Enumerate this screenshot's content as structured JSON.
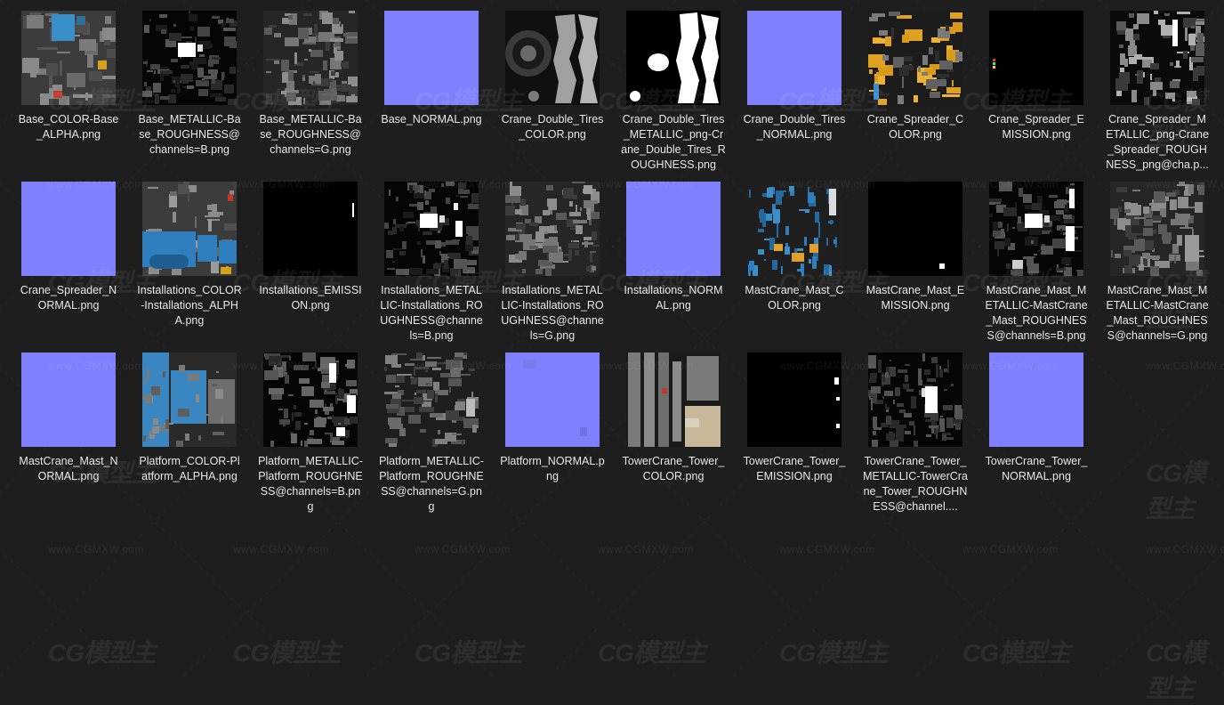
{
  "watermark": {
    "logo": "CG模型主",
    "url": "www.CGMXW.com"
  },
  "files": [
    {
      "name": "Base_COLOR-Base_ALPHA.png",
      "thumb": "color-base",
      "accent": "#3a8fc9"
    },
    {
      "name": "Base_METALLIC-Base_ROUGHNESS@channels=B.png",
      "thumb": "dark-noise",
      "accent": "#ffffff"
    },
    {
      "name": "Base_METALLIC-Base_ROUGHNESS@channels=G.png",
      "thumb": "gray-noise",
      "accent": "#9a9a9a"
    },
    {
      "name": "Base_NORMAL.png",
      "thumb": "normal",
      "accent": "#8080ff"
    },
    {
      "name": "Crane_Double_Tires_COLOR.png",
      "thumb": "tires-gray",
      "accent": "#a8a8a8"
    },
    {
      "name": "Crane_Double_Tires_METALLIC_png-Crane_Double_Tires_ROUGHNESS.png",
      "thumb": "tires-white",
      "accent": "#ffffff"
    },
    {
      "name": "Crane_Double_Tires_NORMAL.png",
      "thumb": "normal",
      "accent": "#8080ff"
    },
    {
      "name": "Crane_Spreader_COLOR.png",
      "thumb": "spreader-color",
      "accent": "#f0b030"
    },
    {
      "name": "Crane_Spreader_EMISSION.png",
      "thumb": "emission-dot",
      "accent": "#ff3030"
    },
    {
      "name": "Crane_Spreader_METALLIC_png-Crane_Spreader_ROUGHNESS_png@cha.p...",
      "thumb": "gray-parts",
      "accent": "#cccccc"
    },
    {
      "name": "Crane_Spreader_NORMAL.png",
      "thumb": "normal",
      "accent": "#8080ff"
    },
    {
      "name": "Installations_COLOR-Installations_ALPHA.png",
      "thumb": "install-color",
      "accent": "#2f7fbf"
    },
    {
      "name": "Installations_EMISSION.png",
      "thumb": "emission-line",
      "accent": "#ffffff"
    },
    {
      "name": "Installations_METALLIC-Installations_ROUGHNESS@channels=B.png",
      "thumb": "dark-noise2",
      "accent": "#ffffff"
    },
    {
      "name": "Installations_METALLIC-Installations_ROUGHNESS@channels=G.png",
      "thumb": "gray-noise2",
      "accent": "#bdbdbd"
    },
    {
      "name": "Installations_NORMAL.png",
      "thumb": "normal",
      "accent": "#8080ff"
    },
    {
      "name": "MastCrane_Mast_COLOR.png",
      "thumb": "mast-color",
      "accent": "#2f7fbf"
    },
    {
      "name": "MastCrane_Mast_EMISSION.png",
      "thumb": "emission-square",
      "accent": "#ffffff"
    },
    {
      "name": "MastCrane_Mast_METALLIC-MastCrane_Mast_ROUGHNESS@channels=B.png",
      "thumb": "dark-noise3",
      "accent": "#ffffff"
    },
    {
      "name": "MastCrane_Mast_METALLIC-MastCrane_Mast_ROUGHNESS@channels=G.png",
      "thumb": "gray-noise3",
      "accent": "#bdbdbd"
    },
    {
      "name": "MastCrane_Mast_NORMAL.png",
      "thumb": "normal",
      "accent": "#8080ff"
    },
    {
      "name": "Platform_COLOR-Platform_ALPHA.png",
      "thumb": "platform-color",
      "accent": "#3a86c0"
    },
    {
      "name": "Platform_METALLIC-Platform_ROUGHNESS@channels=B.png",
      "thumb": "platform-dark",
      "accent": "#ffffff"
    },
    {
      "name": "Platform_METALLIC-Platform_ROUGHNESS@channels=G.png",
      "thumb": "platform-gray",
      "accent": "#bdbdbd"
    },
    {
      "name": "Platform_NORMAL.png",
      "thumb": "normal-variant",
      "accent": "#8080ff"
    },
    {
      "name": "TowerCrane_Tower_COLOR.png",
      "thumb": "tower-color",
      "accent": "#c8b89a"
    },
    {
      "name": "TowerCrane_Tower_EMISSION.png",
      "thumb": "emission-small",
      "accent": "#ffffff"
    },
    {
      "name": "TowerCrane_Tower_METALLIC-TowerCrane_Tower_ROUGHNESS@channel....",
      "thumb": "tower-dark",
      "accent": "#ffffff"
    },
    {
      "name": "TowerCrane_Tower_NORMAL.png",
      "thumb": "normal",
      "accent": "#8080ff"
    }
  ]
}
